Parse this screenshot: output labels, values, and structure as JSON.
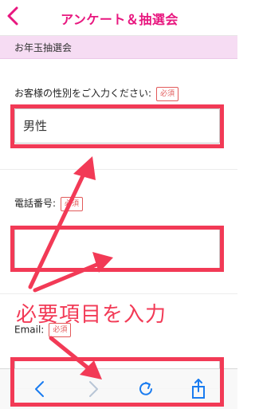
{
  "header": {
    "title": "アンケート＆抽選会",
    "back_icon": "chevron-left-icon"
  },
  "section": {
    "title": "お年玉抽選会"
  },
  "form": {
    "gender": {
      "label": "お客様の性別をご入力ください:",
      "required_badge": "必須",
      "value": "男性"
    },
    "phone": {
      "label": "電話番号:",
      "required_badge": "必須",
      "value": ""
    },
    "email": {
      "label": "Email:",
      "required_badge": "必須",
      "value": ""
    }
  },
  "annotation": {
    "text": "必要項目を入力",
    "color": "#f23a56"
  },
  "toolbar": {
    "items": [
      "back-arrow-icon",
      "forward-arrow-icon",
      "reload-icon",
      "share-icon"
    ]
  },
  "colors": {
    "brand": "#e8177f",
    "section_bg": "#f6dcf3",
    "highlight": "#f23a56"
  }
}
